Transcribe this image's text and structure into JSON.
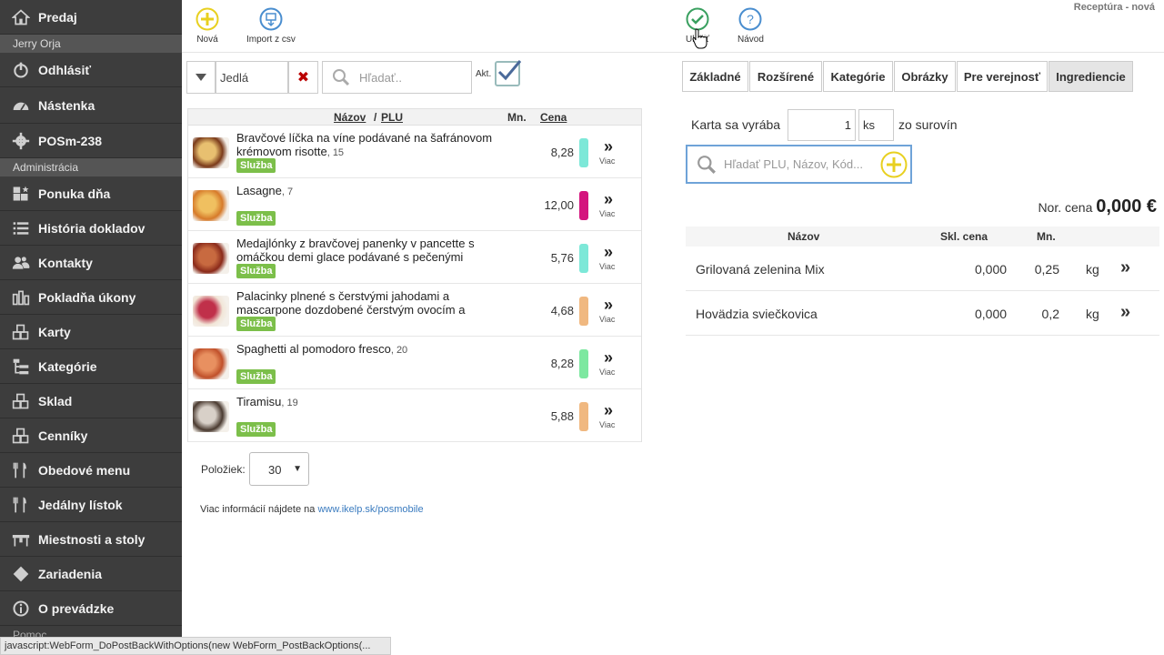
{
  "sidebar": {
    "items": [
      {
        "label": "Predaj",
        "icon": "home-icon"
      },
      {
        "label": "Odhlásiť",
        "icon": "power-icon"
      },
      {
        "label": "Nástenka",
        "icon": "dashboard-icon"
      },
      {
        "label": "POSm-238",
        "icon": "gear-icon"
      },
      {
        "label": "Ponuka dňa",
        "icon": "boxes-star-icon"
      },
      {
        "label": "História dokladov",
        "icon": "list-icon"
      },
      {
        "label": "Kontakty",
        "icon": "users-icon"
      },
      {
        "label": "Pokladňa úkony",
        "icon": "bar-chart-icon"
      },
      {
        "label": "Karty",
        "icon": "boxes-icon"
      },
      {
        "label": "Kategórie",
        "icon": "sitemap-icon"
      },
      {
        "label": "Sklad",
        "icon": "boxes-icon"
      },
      {
        "label": "Cenníky",
        "icon": "boxes-icon"
      },
      {
        "label": "Obedové menu",
        "icon": "cutlery-icon"
      },
      {
        "label": "Jedálny lístok",
        "icon": "cutlery-icon"
      },
      {
        "label": "Miestnosti a stoly",
        "icon": "table-icon"
      },
      {
        "label": "Zariadenia",
        "icon": "diamond-icon"
      },
      {
        "label": "O prevádzke",
        "icon": "info-icon"
      }
    ],
    "user_name": "Jerry Orja",
    "section_admin": "Administrácia",
    "section_help": "Pomoc"
  },
  "toolbar": {
    "new_label": "Nová",
    "import_label": "Import z csv",
    "save_label": "Uložiť",
    "help_label": "Návod",
    "doc_title": "Receptúra - nová"
  },
  "filter": {
    "category": "Jedlá",
    "search_placeholder": "Hľadať..",
    "active_label": "Akt."
  },
  "product_table": {
    "headers": {
      "name": "Názov",
      "sep": "/",
      "plu": "PLU",
      "qty": "Mn.",
      "price": "Cena"
    },
    "more_label": "Viac",
    "rows": [
      {
        "name": "Bravčové líčka na víne podávané na šafránovom krémovom risotte",
        "plu": ", 15",
        "badge": "Služba",
        "price": "8,28",
        "color": "#7de8d8",
        "thumb": [
          "#7a3a1a",
          "#e8c070"
        ]
      },
      {
        "name": "Lasagne",
        "plu": ", 7",
        "badge": "Služba",
        "price": "12,00",
        "color": "#d4157e",
        "thumb": [
          "#d67a2a",
          "#f0c060"
        ]
      },
      {
        "name": "Medajlónky z bravčovej panenky v pancette s omáčkou demi glace podávané s pečenými",
        "plu": "",
        "badge": "Služba",
        "price": "5,76",
        "color": "#7de8d8",
        "thumb": [
          "#8a2a1a",
          "#c86a40"
        ]
      },
      {
        "name": "Palacinky plnené s čerstvými jahodami a mascarpone dozdobené čerstvým ovocím a",
        "plu": "",
        "badge": "Služba",
        "price": "4,68",
        "color": "#f0b880",
        "thumb": [
          "#f2e6d8",
          "#c0304a"
        ]
      },
      {
        "name": "Spaghetti al pomodoro fresco",
        "plu": ", 20",
        "badge": "Služba",
        "price": "8,28",
        "color": "#7de8a0",
        "thumb": [
          "#c0502a",
          "#e89060"
        ]
      },
      {
        "name": "Tiramisu",
        "plu": ", 19",
        "badge": "Služba",
        "price": "5,88",
        "color": "#f0b880",
        "thumb": [
          "#4a3a30",
          "#d8d0c8"
        ]
      }
    ]
  },
  "pagination": {
    "label": "Položiek:",
    "value": "30"
  },
  "info": {
    "text": "Viac informácií nájdete na ",
    "link": "www.ikelp.sk/posmobile"
  },
  "tabs": [
    "Základné",
    "Rozšírené",
    "Kategórie",
    "Obrázky",
    "Pre verejnosť",
    "Ingrediencie"
  ],
  "recipe": {
    "yield_label": "Karta sa vyrába",
    "yield_qty": "1",
    "yield_unit": "ks",
    "yield_suffix": "zo surovín",
    "search_placeholder": "Hľadať PLU, Názov, Kód...",
    "nor_price_label": "Nor. cena",
    "nor_price_value": "0,000 €",
    "headers": {
      "name": "Názov",
      "cost": "Skl. cena",
      "qty": "Mn."
    },
    "ingredients": [
      {
        "name": "Grilovaná zelenina Mix",
        "cost": "0,000",
        "qty": "0,25",
        "unit": "kg"
      },
      {
        "name": "Hovädzia sviečkovica",
        "cost": "0,000",
        "qty": "0,2",
        "unit": "kg"
      }
    ]
  },
  "statusbar": "javascript:WebForm_DoPostBackWithOptions(new WebForm_PostBackOptions(...",
  "colors": {
    "sidebar": "#3d3d3d",
    "badge": "#7cbf4a",
    "accent_blue": "#6fa3d8",
    "add_yellow": "#e8d020",
    "save_green": "#3aa060"
  }
}
